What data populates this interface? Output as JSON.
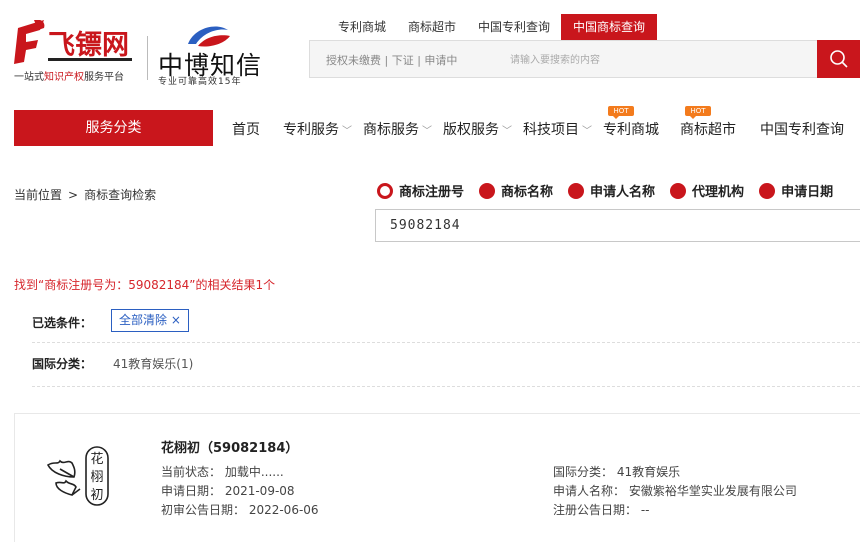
{
  "brand": {
    "logo1_slogan_prefix": "一站式",
    "logo1_slogan_mid": "知识产权",
    "logo1_slogan_suffix": "服务平台",
    "logo2_name": "中博知信",
    "logo2_sub": "专业可靠高效15年"
  },
  "top_tabs": [
    "专利商城",
    "商标超市",
    "中国专利查询",
    "中国商标查询"
  ],
  "top_tabs_active_index": 3,
  "search": {
    "hint": "授权未缴费 | 下证 | 申请中",
    "placeholder": "请输入要搜索的内容"
  },
  "nav": {
    "service_category": "服务分类",
    "items": [
      {
        "label": "首页",
        "dropdown": false,
        "hot": false
      },
      {
        "label": "专利服务",
        "dropdown": true,
        "hot": false
      },
      {
        "label": "商标服务",
        "dropdown": true,
        "hot": false
      },
      {
        "label": "版权服务",
        "dropdown": true,
        "hot": false
      },
      {
        "label": "科技项目",
        "dropdown": true,
        "hot": false
      },
      {
        "label": "专利商城",
        "dropdown": false,
        "hot": true
      },
      {
        "label": "商标超市",
        "dropdown": false,
        "hot": true
      },
      {
        "label": "中国专利查询",
        "dropdown": false,
        "hot": false
      }
    ],
    "hot_badge": "HOT"
  },
  "breadcrumb": {
    "prefix": "当前位置",
    "sep": ">",
    "current": "商标查询检索"
  },
  "query": {
    "options": [
      "商标注册号",
      "商标名称",
      "申请人名称",
      "代理机构",
      "申请日期"
    ],
    "selected_index": 0,
    "value": "59082184"
  },
  "results": {
    "summary": "找到“商标注册号为：59082184”的相关结果1个",
    "selected_label": "已选条件：",
    "clear_all": "全部清除 ×",
    "intl_class_label": "国际分类：",
    "intl_class_value": "41教育娱乐(1)"
  },
  "item": {
    "title": "花栩初（59082184）",
    "logo_chars": [
      "花",
      "栩",
      "初"
    ],
    "status": "当前状态： 加载中......",
    "apply_date": "申请日期： 2021-09-08",
    "prelim_date": "初审公告日期： 2022-06-06",
    "intl_class": "国际分类： 41教育娱乐",
    "applicant": "申请人名称： 安徽紫裕华堂实业发展有限公司",
    "reg_date": "注册公告日期： --"
  },
  "colors": {
    "brand_red": "#c9161c",
    "link_blue": "#2b5fc1",
    "hot_orange": "#f37b1d"
  }
}
